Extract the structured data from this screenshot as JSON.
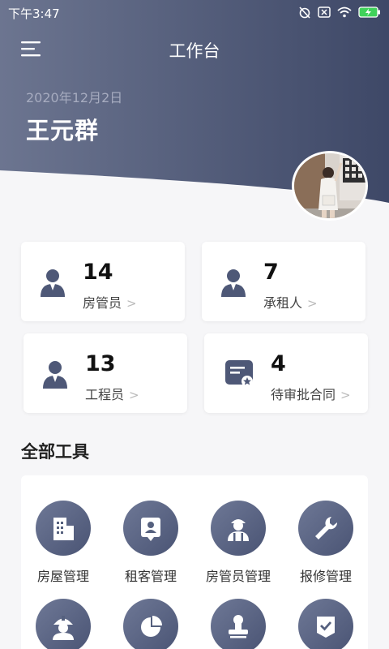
{
  "status": {
    "time": "下午3:47"
  },
  "header": {
    "title": "工作台",
    "date": "2020年12月2日",
    "user_name": "王元群"
  },
  "stats": [
    {
      "value": "14",
      "label": "房管员",
      "icon": "person-icon"
    },
    {
      "value": "7",
      "label": "承租人",
      "icon": "person-icon"
    },
    {
      "value": "13",
      "label": "工程员",
      "icon": "person-icon"
    },
    {
      "value": "4",
      "label": "待审批合同",
      "icon": "contract-icon"
    }
  ],
  "tools_section": {
    "title": "全部工具",
    "items": [
      {
        "label": "房屋管理",
        "icon": "building-icon"
      },
      {
        "label": "租客管理",
        "icon": "id-card-icon"
      },
      {
        "label": "房管员管理",
        "icon": "worker-icon"
      },
      {
        "label": "报修管理",
        "icon": "wrench-icon"
      },
      {
        "label": "",
        "icon": "hardhat-icon"
      },
      {
        "label": "",
        "icon": "pie-chart-icon"
      },
      {
        "label": "",
        "icon": "stamp-icon"
      },
      {
        "label": "",
        "icon": "check-shield-icon"
      }
    ]
  },
  "colors": {
    "header_dark": "#3e4867",
    "header_light": "#6c7590",
    "accent": "#505a78"
  }
}
